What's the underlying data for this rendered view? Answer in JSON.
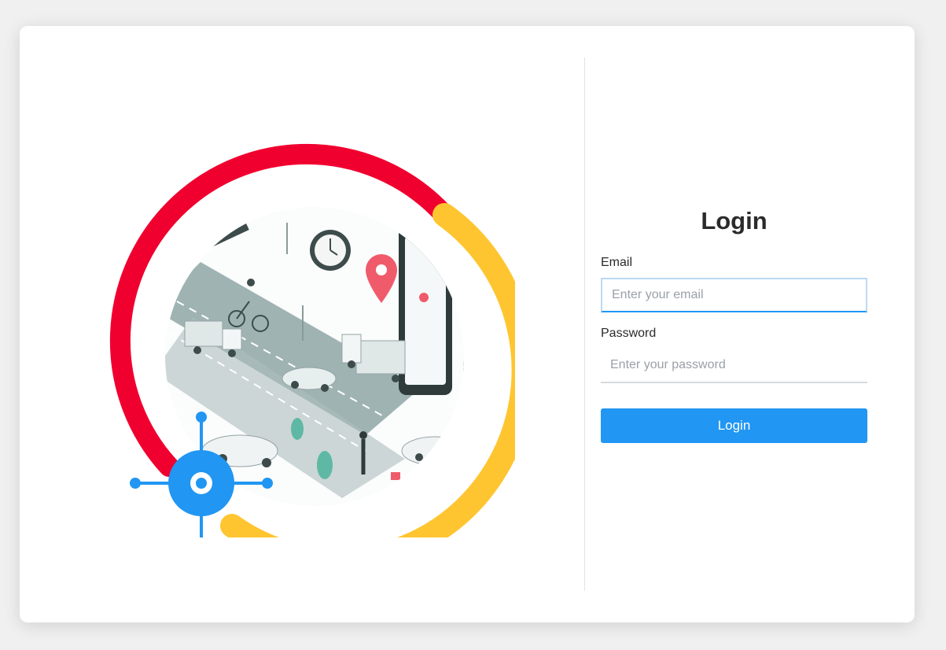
{
  "login": {
    "title": "Login",
    "email_label": "Email",
    "email_placeholder": "Enter your email",
    "email_value": "",
    "password_label": "Password",
    "password_placeholder": "Enter your password",
    "password_value": "",
    "submit_label": "Login"
  },
  "illustration": {
    "icon": "location-target-icon"
  },
  "colors": {
    "primary": "#2196f3",
    "ring_red": "#f0002f",
    "ring_yellow": "#ffc530",
    "title_text": "#2b2b2b"
  }
}
